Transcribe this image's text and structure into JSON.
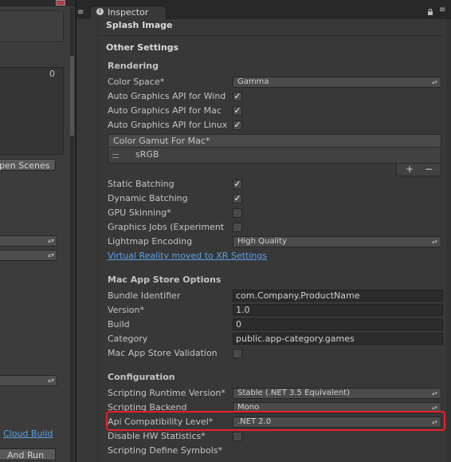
{
  "left_panel": {
    "counter": "0",
    "open_scenes_button": "pen Scenes",
    "cloud_build_link": "Cloud Build",
    "build_and_run_button": "And Run"
  },
  "inspector": {
    "tab_label": "Inspector",
    "splash_image": "Splash Image",
    "other_settings": "Other Settings",
    "rendering": {
      "title": "Rendering",
      "color_space_label": "Color Space*",
      "color_space_value": "Gamma",
      "auto_gfx_windows_label": "Auto Graphics API for Wind",
      "auto_gfx_mac_label": "Auto Graphics API for Mac",
      "auto_gfx_linux_label": "Auto Graphics API for Linux",
      "color_gamut_header": "Color Gamut For Mac*",
      "color_gamut_item": "sRGB",
      "static_batching_label": "Static Batching",
      "dynamic_batching_label": "Dynamic Batching",
      "gpu_skinning_label": "GPU Skinning*",
      "graphics_jobs_label": "Graphics Jobs (Experiment",
      "lightmap_encoding_label": "Lightmap Encoding",
      "lightmap_encoding_value": "High Quality",
      "vr_link": "Virtual Reality moved to XR Settings"
    },
    "mac_app_store": {
      "title": "Mac App Store Options",
      "bundle_identifier_label": "Bundle Identifier",
      "bundle_identifier_value": "com.Company.ProductName",
      "version_label": "Version*",
      "version_value": "1.0",
      "build_label": "Build",
      "build_value": "0",
      "category_label": "Category",
      "category_value": "public.app-category.games",
      "validation_label": "Mac App Store Validation"
    },
    "configuration": {
      "title": "Configuration",
      "scripting_runtime_label": "Scripting Runtime Version*",
      "scripting_runtime_value": "Stable (.NET 3.5 Equivalent)",
      "scripting_backend_label": "Scripting Backend",
      "scripting_backend_value": "Mono",
      "api_compat_label": "Api Compatibility Level*",
      "api_compat_value": ".NET 2.0",
      "disable_hw_stats_label": "Disable HW Statistics*",
      "scripting_define_label": "Scripting Define Symbols*"
    },
    "checkboxes": {
      "auto_gfx_windows": true,
      "auto_gfx_mac": true,
      "auto_gfx_linux": true,
      "static_batching": true,
      "dynamic_batching": true,
      "gpu_skinning": false,
      "graphics_jobs": false,
      "mac_app_store_validation": false,
      "disable_hw_statistics": false
    },
    "colors": {
      "highlight": "#e8202a",
      "link": "#5ba0e6",
      "background": "#383838"
    }
  }
}
